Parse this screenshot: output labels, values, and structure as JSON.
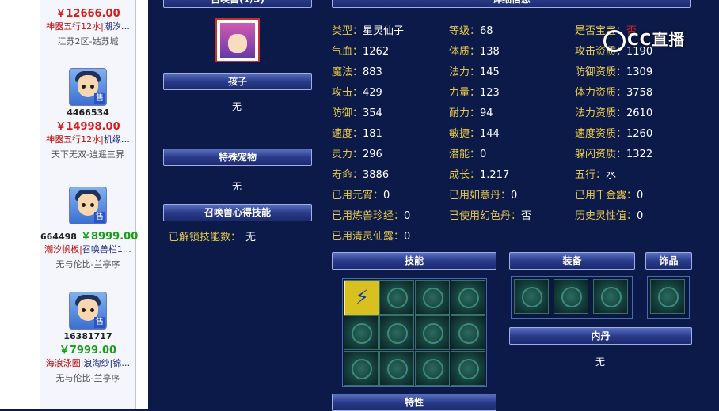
{
  "left_list": [
    {
      "id": "",
      "price": "￥12666.00",
      "tags_red": "神器五行12水",
      "tags_blue": "潮汐…",
      "server": "江苏2区-姑苏城",
      "avatar_mark": "售"
    },
    {
      "id": "4466534",
      "price": "￥14998.00",
      "tags_red": "神器五行12水",
      "tags_blue": "机缘…",
      "server": "天下无双-逍遥三界",
      "avatar_mark": "售"
    },
    {
      "id": "664498",
      "price": "￥8999.00",
      "tags_red": "潮汐帆板",
      "tags_blue": "召唤兽栏1…",
      "server": "无与伦比-兰亭序",
      "avatar_mark": "售"
    },
    {
      "id": "16381717",
      "price": "￥7999.00",
      "tags_red": "海浪泳圈",
      "tags_blue": "浪淘纱|锦…",
      "server": "无与伦比-兰亭序",
      "avatar_mark": "售"
    }
  ],
  "panel": {
    "summon_header": "召唤兽(1/5)",
    "detail_header": "详细信息",
    "child_header": "孩子",
    "child_value": "无",
    "special_pet_header": "特殊宠物",
    "special_pet_value": "无",
    "skill_insight_header": "召唤兽心得技能",
    "unlocked_label": "已解锁技能数：",
    "unlocked_value": "无",
    "skills_header": "技能",
    "equip_header": "装备",
    "ornament_header": "饰品",
    "inner_pill_header": "内丹",
    "inner_pill_value": "无",
    "traits_header": "特性"
  },
  "stats": [
    {
      "k": "类型：",
      "v": "星灵仙子"
    },
    {
      "k": "等级：",
      "v": "68"
    },
    {
      "k": "是否宝宝：",
      "v": "否"
    },
    {
      "k": "气血：",
      "v": "1262"
    },
    {
      "k": "体质：",
      "v": "138"
    },
    {
      "k": "攻击资质：",
      "v": "1190"
    },
    {
      "k": "魔法：",
      "v": "883"
    },
    {
      "k": "法力：",
      "v": "145"
    },
    {
      "k": "防御资质：",
      "v": "1309"
    },
    {
      "k": "攻击：",
      "v": "429"
    },
    {
      "k": "力量：",
      "v": "123"
    },
    {
      "k": "体力资质：",
      "v": "3758"
    },
    {
      "k": "防御：",
      "v": "354"
    },
    {
      "k": "耐力：",
      "v": "94"
    },
    {
      "k": "法力资质：",
      "v": "2610"
    },
    {
      "k": "速度：",
      "v": "181"
    },
    {
      "k": "敏捷：",
      "v": "144"
    },
    {
      "k": "速度资质：",
      "v": "1260"
    },
    {
      "k": "灵力：",
      "v": "296"
    },
    {
      "k": "潜能：",
      "v": "0"
    },
    {
      "k": "躲闪资质：",
      "v": "1322"
    },
    {
      "k": "寿命：",
      "v": "3886"
    },
    {
      "k": "成长：",
      "v": "1.217"
    },
    {
      "k": "五行：",
      "v": "水"
    },
    {
      "k": "已用元宵：",
      "v": "0"
    },
    {
      "k": "已用如意丹：",
      "v": "0"
    },
    {
      "k": "已用千金露：",
      "v": "0"
    },
    {
      "k": "已用炼兽珍经：",
      "v": "0"
    },
    {
      "k": "已使用幻色丹：",
      "v": "否"
    },
    {
      "k": "历史灵性值：",
      "v": "0"
    },
    {
      "k": "已用清灵仙露：",
      "v": "0"
    }
  ],
  "watermark": {
    "brand": "CC直播"
  }
}
